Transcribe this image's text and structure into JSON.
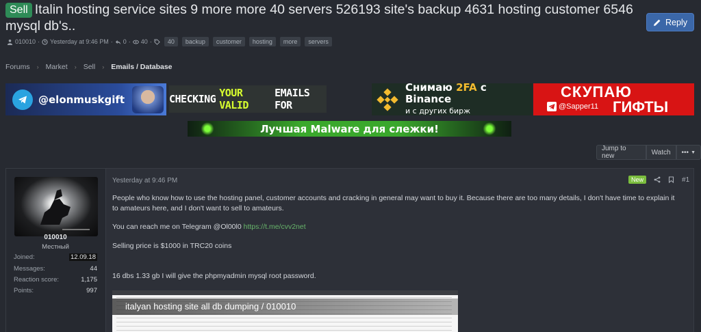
{
  "thread": {
    "prefix": "Sell",
    "title": "Italin hosting service sites 9 more more 40 servers 526193 site's backup 4631 hosting customer 6546 mysql db's..",
    "author": "010010",
    "date": "Yesterday at 9:46 PM",
    "replies": "0",
    "views": "40",
    "tags": [
      "40",
      "backup",
      "customer",
      "hosting",
      "more",
      "servers"
    ]
  },
  "header": {
    "reply_label": "Reply"
  },
  "breadcrumb": [
    "Forums",
    "Market",
    "Sell",
    "Emails / Database"
  ],
  "banners": {
    "b1": "@elonmuskgift",
    "b2_pre": "CHECKING",
    "b2_hl": "YOUR VALID",
    "b2_post": "EMAILS FOR",
    "b3_line1_pre": "Снимаю",
    "b3_line1_hl": "2FA",
    "b3_line1_mid": "с",
    "b3_line1_post": "Binance",
    "b3_line2": "и с других бирж",
    "b4_line1": "СКУПАЮ",
    "b4_handle": "@Sapper11",
    "b4_line2": "ГИФТЫ",
    "b5": "Лучшая Malware для слежки!"
  },
  "thread_actions": {
    "jump_new": "Jump to new",
    "watch": "Watch",
    "more": "•••"
  },
  "post": {
    "date": "Yesterday at 9:46 PM",
    "badge": "New",
    "number": "#1",
    "user": {
      "name": "010010",
      "title": "Местный",
      "stats": [
        {
          "label": "Joined:",
          "value": "12.09.18"
        },
        {
          "label": "Messages:",
          "value": "44"
        },
        {
          "label": "Reaction score:",
          "value": "1,175"
        },
        {
          "label": "Points:",
          "value": "997"
        }
      ]
    },
    "paragraphs": {
      "p1": "People who know how to use the hosting panel, customer accounts and cracking in general may want to buy it. Because there are too many details, I don't have time to explain it to amateurs here, and I don't want to sell to amateurs.",
      "p2_text": "You can reach me on Telegram @Ol00l0",
      "p2_link": "https://t.me/cvv2net",
      "p3": "Selling price is $1000 in TRC20 coins",
      "p4": "16 dbs 1.33 gb I will give the phpmyadmin mysql root password."
    },
    "screenshot_caption": "italyan hosting site all db dumping / 010010"
  }
}
